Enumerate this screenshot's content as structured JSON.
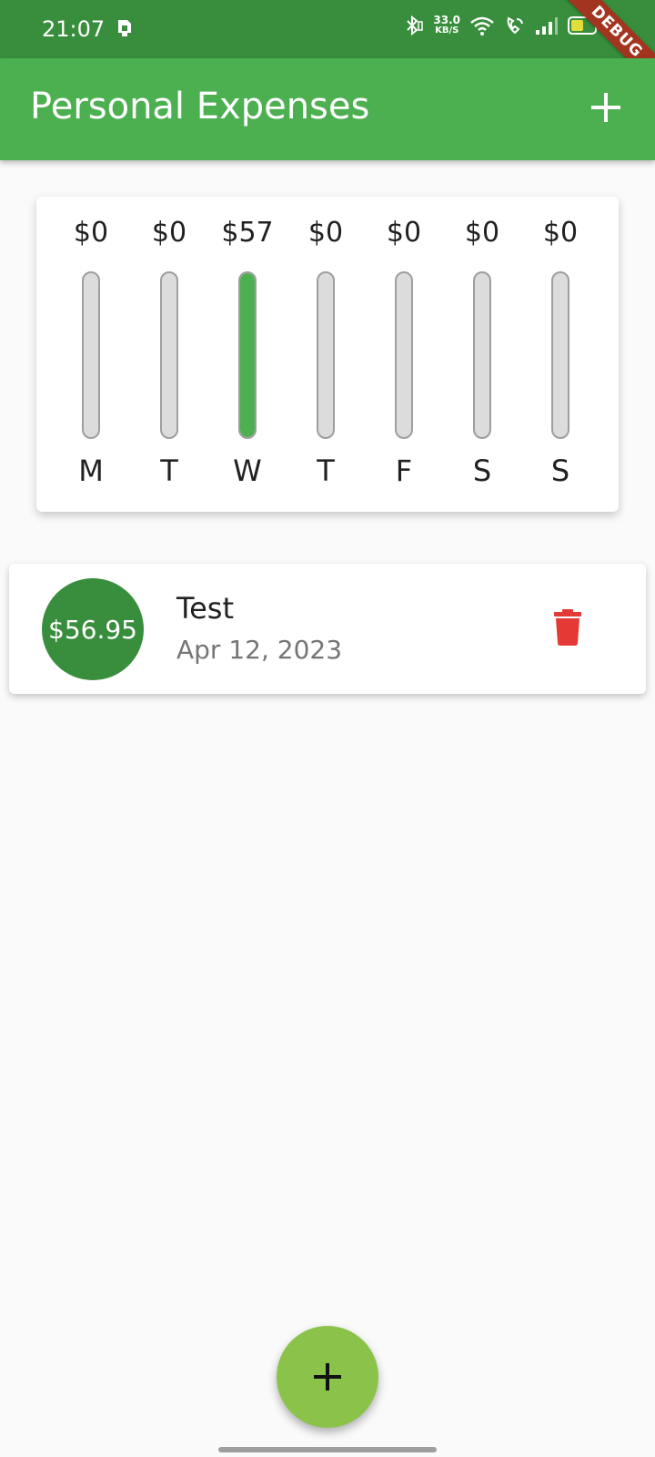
{
  "status_bar": {
    "time": "21:07",
    "net_speed_value": "33.0",
    "net_speed_unit": "KB/S",
    "battery_level": "42",
    "debug_label": "DEBUG"
  },
  "app_bar": {
    "title": "Personal Expenses",
    "add_icon": "plus-icon"
  },
  "chart_data": {
    "type": "bar",
    "categories": [
      "M",
      "T",
      "W",
      "T",
      "F",
      "S",
      "S"
    ],
    "labels": [
      "$0",
      "$0",
      "$57",
      "$0",
      "$0",
      "$0",
      "$0"
    ],
    "values": [
      0,
      0,
      56.95,
      0,
      0,
      0,
      0
    ],
    "fill_fraction": [
      0,
      0,
      1,
      0,
      0,
      0,
      0
    ]
  },
  "transactions": [
    {
      "amount": "$56.95",
      "title": "Test",
      "date": "Apr 12, 2023",
      "delete_icon": "trash-icon"
    }
  ],
  "fab": {
    "icon": "plus-icon"
  },
  "colors": {
    "primary": "#4caf50",
    "primary_dark": "#388e3c",
    "accent": "#8bc34a",
    "delete": "#e53935",
    "bar_empty": "#dcdcdc"
  }
}
